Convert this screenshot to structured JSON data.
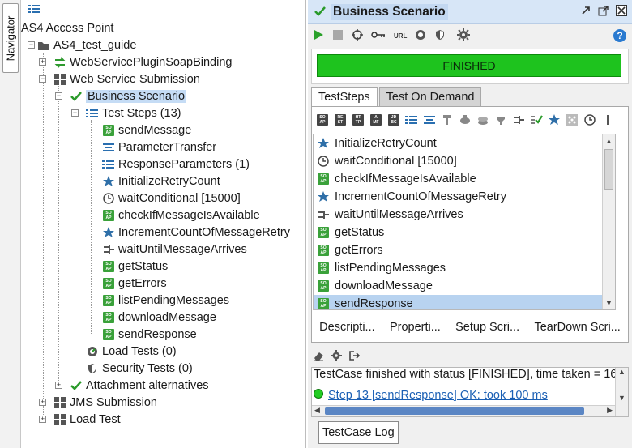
{
  "navigator": {
    "tab_label": "Navigator"
  },
  "tree": {
    "root": "AS4 Access Point",
    "project": "AS4_test_guide",
    "binding": "WebServicePluginSoapBinding",
    "suite": "Web Service Submission",
    "testcase": "Business Scenario",
    "teststeps": "Test Steps (13)",
    "steps": [
      "sendMessage",
      "ParameterTransfer",
      "ResponseParameters (1)",
      "InitializeRetryCount",
      "waitConditional [15000]",
      "checkIfMessageIsAvailable",
      "IncrementCountOfMessageRetry",
      "waitUntilMessageArrives",
      "getStatus",
      "getErrors",
      "listPendingMessages",
      "downloadMessage",
      "sendResponse"
    ],
    "load_tests": "Load Tests (0)",
    "security_tests": "Security Tests (0)",
    "attachment": "Attachment alternatives",
    "jms": "JMS Submission",
    "load_test": "Load Test"
  },
  "panel": {
    "title": "Business Scenario",
    "status": "FINISHED",
    "tabs": [
      "TestSteps",
      "Test On Demand"
    ],
    "list": [
      "InitializeRetryCount",
      "waitConditional [15000]",
      "checkIfMessageIsAvailable",
      "IncrementCountOfMessageRetry",
      "waitUntilMessageArrives",
      "getStatus",
      "getErrors",
      "listPendingMessages",
      "downloadMessage",
      "sendResponse"
    ],
    "subtabs": [
      "Descripti...",
      "Properti...",
      "Setup Scri...",
      "TearDown Scri..."
    ],
    "log": {
      "line1": "TestCase finished with status [FINISHED], time taken = 16",
      "line2": "Step 13 [sendResponse] OK: took 100 ms"
    },
    "log_button": "TestCase Log"
  },
  "colors": {
    "status_green": "#1ec31e",
    "selection": "#c5dcf5",
    "accent_blue": "#1a5fb4"
  }
}
